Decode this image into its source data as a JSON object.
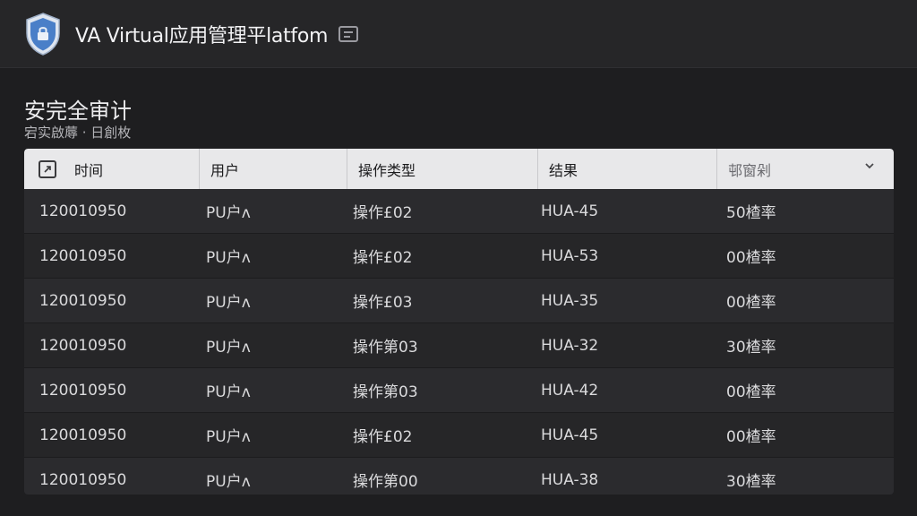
{
  "app": {
    "title": "VA Virtual应用管理平latfom",
    "accent": "#4a7fc8"
  },
  "page": {
    "title": "安完全审计",
    "subtitle": "宕实啟蓐 · 日創枚"
  },
  "table": {
    "columns": [
      "时间",
      "用户",
      "操作类型",
      "结果",
      "邨窗剁"
    ],
    "rows": [
      [
        "120010950",
        "PU户ʌ",
        "操作£02",
        "HUA-45",
        "50楂率"
      ],
      [
        "120010950",
        "PU户ʌ",
        "操作£02",
        "HUA-53",
        "00楂率"
      ],
      [
        "120010950",
        "PU户ʌ",
        "操作£03",
        "HUA-35",
        "00楂率"
      ],
      [
        "120010950",
        "PU户ʌ",
        "操作第03",
        "HUA-32",
        "30楂率"
      ],
      [
        "120010950",
        "PU户ʌ",
        "操作第03",
        "HUA-42",
        "00楂率"
      ],
      [
        "120010950",
        "PU户ʌ",
        "操作£02",
        "HUA-45",
        "00楂率"
      ],
      [
        "120010950",
        "PU户ʌ",
        "操作第00",
        "HUA-38",
        "30楂率"
      ]
    ]
  },
  "icons": {
    "logo": "shield-lock-icon",
    "title_action": "document-icon",
    "sort": "expand-icon",
    "column_menu": "chevron-down-icon"
  }
}
